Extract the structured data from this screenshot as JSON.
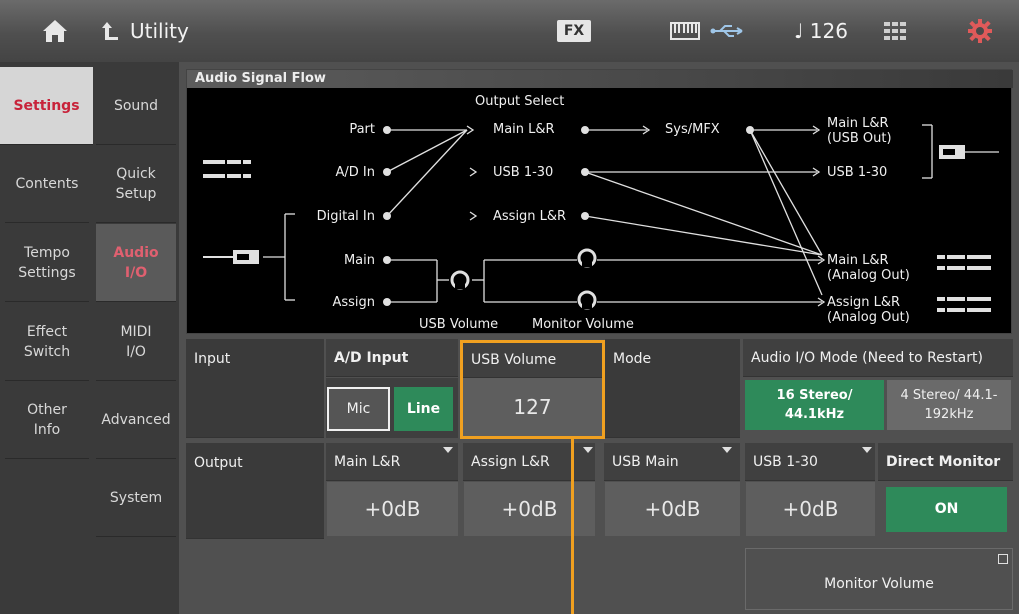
{
  "header": {
    "title": "Utility",
    "fx": "FX",
    "tempo": "♩ 126"
  },
  "nav1": [
    {
      "label": "Settings"
    },
    {
      "label": "Contents"
    },
    {
      "label": "Tempo Settings"
    },
    {
      "label": "Effect Switch"
    },
    {
      "label": "Other Info"
    }
  ],
  "nav2": [
    {
      "label": "Sound"
    },
    {
      "label": "Quick Setup"
    },
    {
      "label": "Audio I/O"
    },
    {
      "label": "MIDI I/O"
    },
    {
      "label": "Advanced"
    },
    {
      "label": "System"
    }
  ],
  "flow": {
    "title": "Audio Signal Flow",
    "output_select": "Output Select",
    "part": "Part",
    "ad_in": "A/D In",
    "digital_in": "Digital In",
    "main": "Main",
    "assign": "Assign",
    "main_lr": "Main L&R",
    "usb_1_30": "USB 1-30",
    "assign_lr": "Assign L&R",
    "sys_mfx": "Sys/MFX",
    "out_main_usb": "Main L&R (USB Out)",
    "out_usb": "USB 1-30",
    "out_main_analog": "Main L&R (Analog Out)",
    "out_assign_analog": "Assign L&R (Analog Out)",
    "usb_volume": "USB Volume",
    "monitor_volume": "Monitor Volume"
  },
  "input": {
    "label": "Input",
    "ad_input": "A/D Input",
    "mic": "Mic",
    "line": "Line",
    "usb_volume": "USB Volume",
    "usb_volume_value": "127",
    "mode": "Mode",
    "audio_mode_label": "Audio I/O Mode (Need to Restart)",
    "mode_opt1": "16 Stereo/ 44.1kHz",
    "mode_opt2": "4 Stereo/ 44.1-192kHz"
  },
  "output": {
    "label": "Output",
    "main_lr": "Main L&R",
    "main_lr_value": "+0dB",
    "assign_lr": "Assign L&R",
    "assign_lr_value": "+0dB",
    "usb_main": "USB Main",
    "usb_main_value": "+0dB",
    "usb_1_30": "USB 1-30",
    "usb_1_30_value": "+0dB",
    "direct_monitor": "Direct Monitor",
    "direct_monitor_value": "ON",
    "monitor_volume": "Monitor Volume"
  },
  "colors": {
    "accent_red": "#c8233a",
    "green": "#2e8a5a",
    "highlight": "#f0a020"
  },
  "icons": [
    "home-icon",
    "back-icon",
    "keyboard-icon",
    "usb-icon",
    "grid-icon",
    "gear-icon",
    "popup-icon"
  ]
}
